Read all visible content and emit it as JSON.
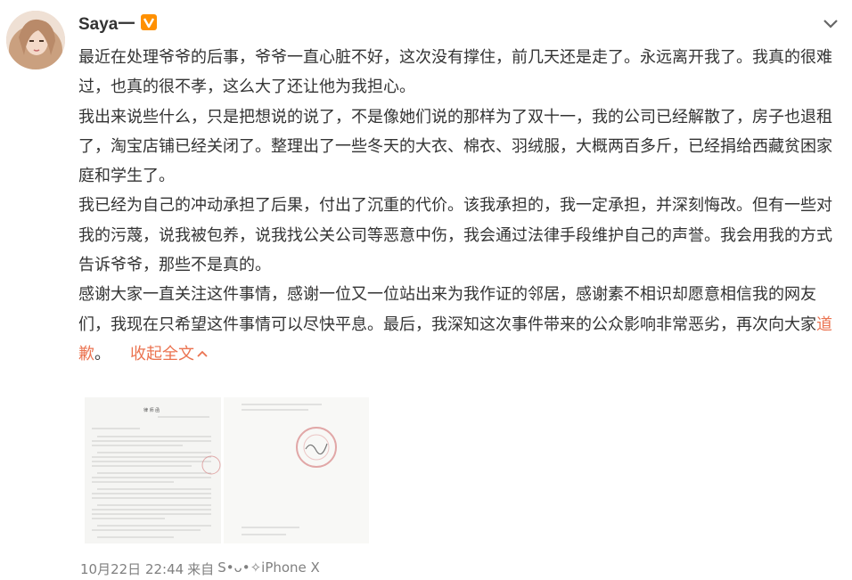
{
  "post": {
    "username": "Saya一",
    "verified_badge": "V",
    "badge_color": "#ff9000",
    "accent_link_color": "#eb7350",
    "paragraphs": [
      "最近在处理爷爷的后事，爷爷一直心脏不好，这次没有撑住，前几天还是走了。永远离开我了。我真的很难过，也真的很不孝，这么大了还让他为我担心。",
      "我出来说些什么，只是把想说的说了，不是像她们说的那样为了双十一，我的公司已经解散了，房子也退租了，淘宝店铺已经关闭了。整理出了一些冬天的大衣、棉衣、羽绒服，大概两百多斤，已经捐给西藏贫困家庭和学生了。",
      "我已经为自己的冲动承担了后果，付出了沉重的代价。该我承担的，我一定承担，并深刻悔改。但有一些对我的污蔑，说我被包养，说我找公关公司等恶意中伤，我会通过法律手段维护自己的声誉。我会用我的方式告诉爷爷，那些不是真的。",
      "感谢大家一直关注这件事情，感谢一位又一位站出来为我作证的邻居，感谢素不相识却愿意相信我的网友们，我现在只希望这件事情可以尽快平息。最后，我深知这次事件带来的公众影响非常恶劣，再次向大家"
    ],
    "last_link": "道歉",
    "last_end": "。",
    "collapse_label": "收起全文",
    "images": [
      {
        "title": "律 师 函"
      },
      {
        "title": ""
      }
    ],
    "meta": {
      "date_time": "10月22日 22:44",
      "from_label": "来自",
      "source": "S•ᴗ•✧iPhone X"
    },
    "icons": {
      "avatar": "avatar-photo",
      "more": "chevron-down-icon",
      "collapse": "chevron-up-icon"
    }
  }
}
